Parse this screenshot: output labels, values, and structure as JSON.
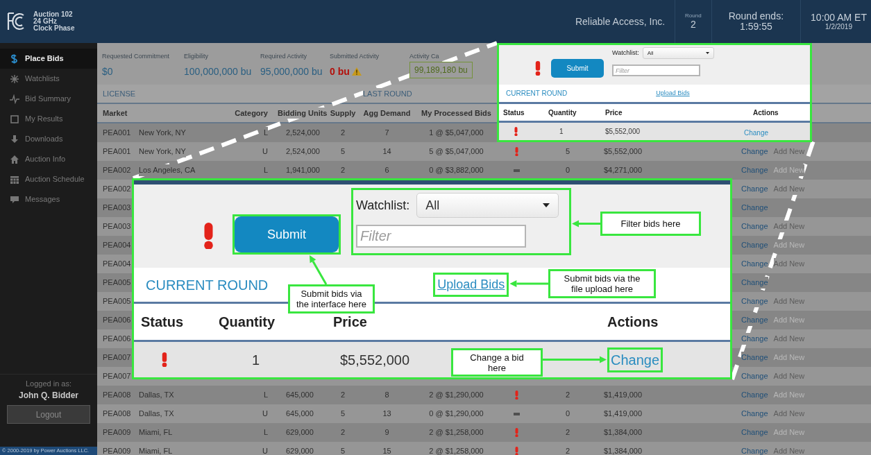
{
  "header": {
    "auction_lines": [
      "Auction 102",
      "24 GHz",
      "Clock Phase"
    ],
    "bidder": "Reliable Access, Inc.",
    "round_label": "Round",
    "round": "2",
    "round_ends_label": "Round ends:",
    "round_ends": "1:59:55",
    "time": "10:00 AM ET",
    "date": "1/2/2019"
  },
  "sidebar": {
    "items": [
      {
        "label": "Place Bids",
        "selected": true
      },
      {
        "label": "Watchlists",
        "selected": false
      },
      {
        "label": "Bid Summary",
        "selected": false
      },
      {
        "label": "My Results",
        "selected": false
      },
      {
        "label": "Downloads",
        "selected": false
      },
      {
        "label": "Auction Info",
        "selected": false
      },
      {
        "label": "Auction Schedule",
        "selected": false
      },
      {
        "label": "Messages",
        "selected": false
      }
    ],
    "logged_in_label": "Logged in as:",
    "user": "John Q. Bidder",
    "logout": "Logout",
    "copyright": "© 2000-2019 by Power Auctions LLC."
  },
  "summary": [
    {
      "label": "Requested Commitment",
      "value": "$0",
      "kind": "plain"
    },
    {
      "label": "Eligibility",
      "value": "100,000,000 bu",
      "kind": "plain"
    },
    {
      "label": "Required Activity",
      "value": "95,000,000 bu",
      "kind": "plain"
    },
    {
      "label": "Submitted Activity",
      "value": "0 bu",
      "kind": "warning"
    },
    {
      "label": "Activity Ca",
      "value": "99,189,180 bu",
      "kind": "boxed"
    }
  ],
  "table": {
    "groups": [
      "LICENSE",
      "LAST ROUND"
    ],
    "columns": [
      "Market",
      "Category",
      "Bidding Units",
      "Supply",
      "Agg Demand",
      "My Processed Bids"
    ],
    "rows": [
      {
        "market": "PEA001",
        "name": "New York, NY",
        "category": "L",
        "units": "2,524,000",
        "supply": "2",
        "demand": "7",
        "processed": "1 @ $5,047,000"
      },
      {
        "market": "PEA001",
        "name": "New York, NY",
        "category": "U",
        "units": "2,524,000",
        "supply": "5",
        "demand": "14",
        "processed": "5 @ $5,047,000",
        "status": {
          "kind": "alert"
        },
        "quantity": "5",
        "price": "$5,552,000",
        "actions": [
          {
            "label": "Change"
          },
          {
            "label": "Add New",
            "disabled": false
          }
        ]
      },
      {
        "market": "PEA002",
        "name": "Los Angeles, CA",
        "category": "L",
        "units": "1,941,000",
        "supply": "2",
        "demand": "6",
        "processed": "0 @ $3,882,000",
        "status": {
          "kind": "unchanged"
        },
        "quantity": "0",
        "price": "$4,271,000",
        "actions": [
          {
            "label": "Change"
          },
          {
            "label": "Add New",
            "disabled": true
          }
        ]
      },
      {
        "market": "PEA002",
        "actions": [
          {
            "label": "Change"
          },
          {
            "label": "Add New",
            "disabled": false
          }
        ]
      },
      {
        "market": "PEA003",
        "actions": [
          {
            "label": "Change"
          }
        ]
      },
      {
        "market": "PEA003",
        "actions": [
          {
            "label": "Change"
          },
          {
            "label": "Add New",
            "disabled": false
          }
        ]
      },
      {
        "market": "PEA004",
        "actions": [
          {
            "label": "Change"
          },
          {
            "label": "Add New",
            "disabled": true
          }
        ]
      },
      {
        "market": "PEA004",
        "actions": [
          {
            "label": "Change"
          },
          {
            "label": "Add New",
            "disabled": false
          }
        ]
      },
      {
        "market": "PEA005",
        "actions": [
          {
            "label": "Change"
          }
        ]
      },
      {
        "market": "PEA005",
        "actions": [
          {
            "label": "Change"
          },
          {
            "label": "Add New",
            "disabled": false
          }
        ]
      },
      {
        "market": "PEA006",
        "actions": [
          {
            "label": "Change"
          },
          {
            "label": "Add New",
            "disabled": true
          }
        ]
      },
      {
        "market": "PEA006",
        "actions": [
          {
            "label": "Change"
          },
          {
            "label": "Add New",
            "disabled": false
          }
        ]
      },
      {
        "market": "PEA007",
        "actions": [
          {
            "label": "Change"
          },
          {
            "label": "Add New",
            "disabled": true
          }
        ]
      },
      {
        "market": "PEA007",
        "actions": [
          {
            "label": "Change"
          },
          {
            "label": "Add New",
            "disabled": false
          }
        ]
      },
      {
        "market": "PEA008",
        "name": "Dallas, TX",
        "category": "L",
        "units": "645,000",
        "supply": "2",
        "demand": "8",
        "processed": "2 @ $1,290,000",
        "status": {
          "kind": "alert"
        },
        "quantity": "2",
        "price": "$1,419,000",
        "actions": [
          {
            "label": "Change"
          },
          {
            "label": "Add New",
            "disabled": true
          }
        ]
      },
      {
        "market": "PEA008",
        "name": "Dallas, TX",
        "category": "U",
        "units": "645,000",
        "supply": "5",
        "demand": "13",
        "processed": "0 @ $1,290,000",
        "status": {
          "kind": "unchanged"
        },
        "quantity": "0",
        "price": "$1,419,000",
        "actions": [
          {
            "label": "Change"
          },
          {
            "label": "Add New",
            "disabled": false
          }
        ]
      },
      {
        "market": "PEA009",
        "name": "Miami, FL",
        "category": "L",
        "units": "629,000",
        "supply": "2",
        "demand": "9",
        "processed": "2 @ $1,258,000",
        "status": {
          "kind": "alert"
        },
        "quantity": "2",
        "price": "$1,384,000",
        "actions": [
          {
            "label": "Change"
          },
          {
            "label": "Add New",
            "disabled": true
          }
        ]
      },
      {
        "market": "PEA009",
        "name": "Miami, FL",
        "category": "U",
        "units": "629,000",
        "supply": "5",
        "demand": "15",
        "processed": "2 @ $1,258,000",
        "status": {
          "kind": "alert"
        },
        "quantity": "2",
        "price": "$1,384,000",
        "actions": [
          {
            "label": "Change"
          },
          {
            "label": "Add New",
            "disabled": false
          }
        ]
      }
    ]
  },
  "zoom_small": {
    "submit": "Submit",
    "watchlist_label": "Watchlist:",
    "watchlist_value": "All",
    "filter_placeholder": "Filter",
    "section_title": "CURRENT ROUND",
    "upload_link": "Upload Bids",
    "columns": [
      "Status",
      "Quantity",
      "Price",
      "Actions"
    ],
    "row": {
      "status": {
        "kind": "alert"
      },
      "quantity": "1",
      "price": "$5,552,000",
      "action": "Change"
    }
  },
  "zoom_large": {
    "submit": "Submit",
    "watchlist_label": "Watchlist:",
    "watchlist_value": "All",
    "filter_placeholder": "Filter",
    "section_title": "CURRENT ROUND",
    "upload_link": "Upload Bids",
    "columns": [
      "Status",
      "Quantity",
      "Price",
      "Actions"
    ],
    "row": {
      "status": {
        "kind": "alert"
      },
      "quantity": "1",
      "price": "$5,552,000",
      "action": "Change"
    }
  },
  "annotations": [
    {
      "text": "Submit bids via the interface here"
    },
    {
      "text": "Filter bids here"
    },
    {
      "text": "Submit bids via the file upload here"
    },
    {
      "text": "Change a bid here"
    }
  ]
}
